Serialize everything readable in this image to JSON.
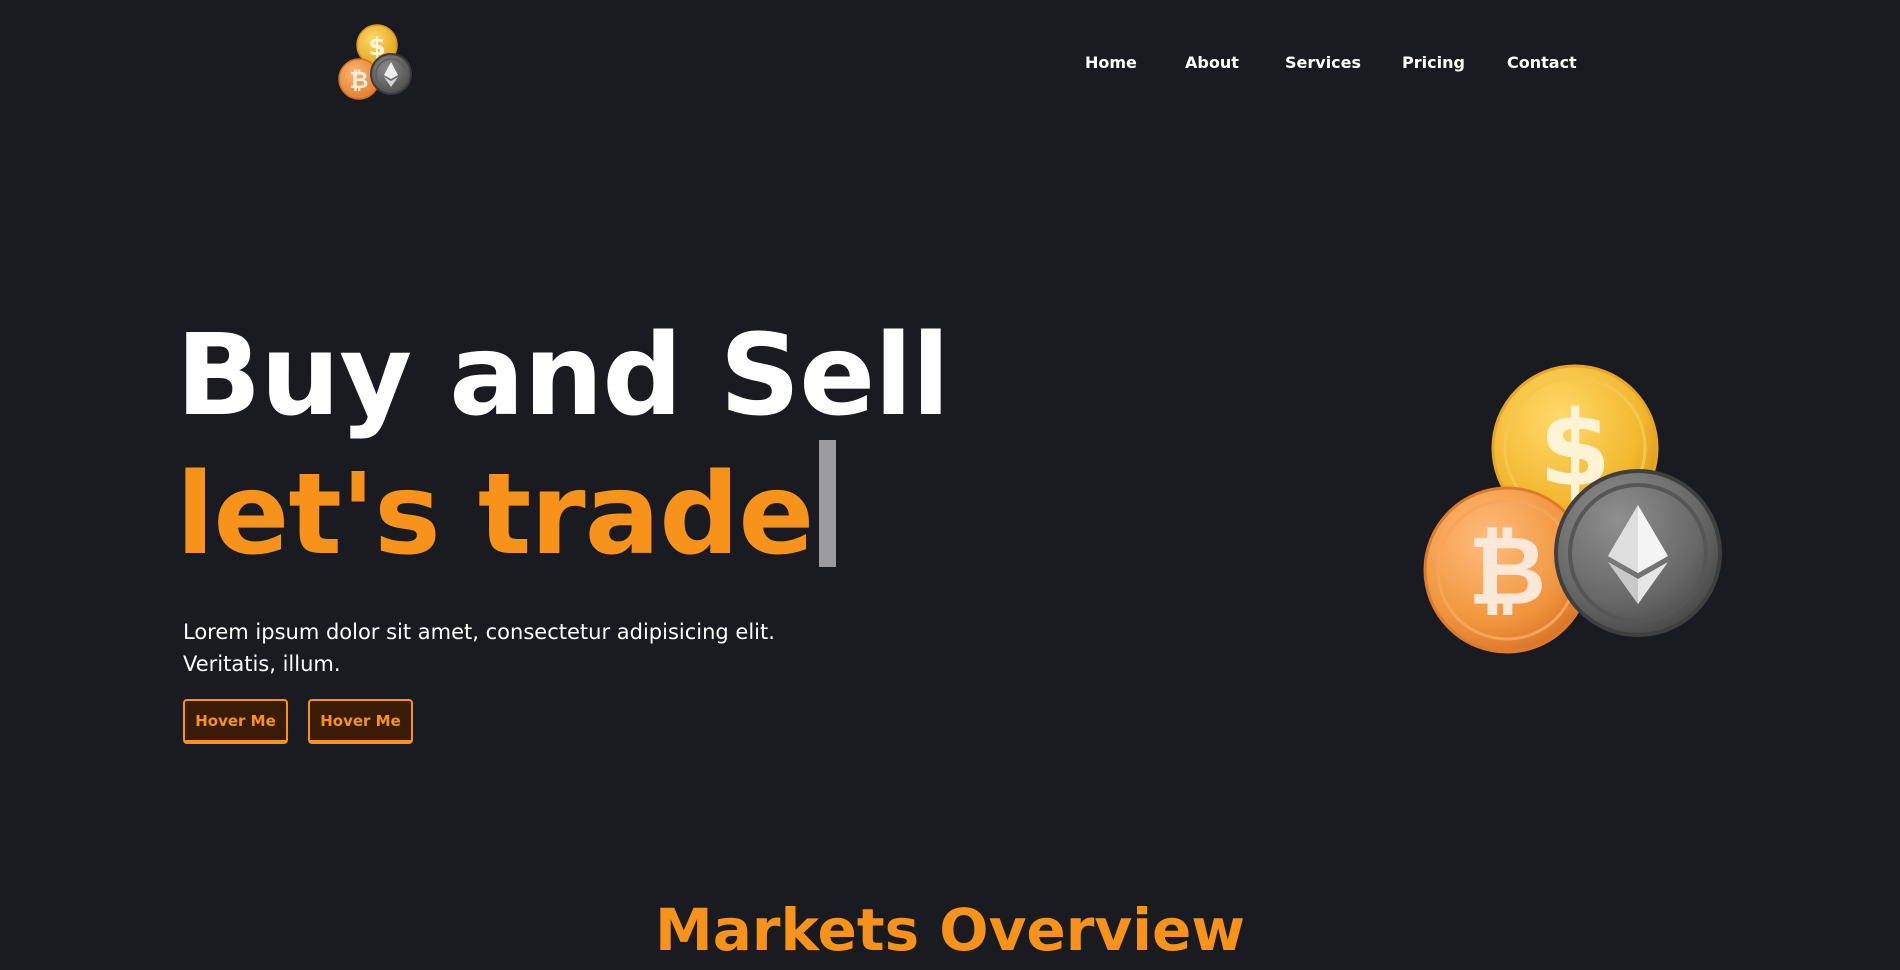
{
  "brand": {
    "logo_icon": "crypto-coins-icon"
  },
  "nav": {
    "items": [
      {
        "label": "Home"
      },
      {
        "label": "About"
      },
      {
        "label": "Services"
      },
      {
        "label": "Pricing"
      },
      {
        "label": "Contact"
      }
    ]
  },
  "hero": {
    "title_line1": "Buy and Sell",
    "title_line2": "let's trade",
    "description": "Lorem ipsum dolor sit amet, consectetur adipisicing elit. Veritatis, illum.",
    "buttons": [
      {
        "label": "Hover Me"
      },
      {
        "label": "Hover Me"
      }
    ],
    "illustration": "crypto-coins-illustration"
  },
  "markets": {
    "title": "Markets Overview"
  },
  "colors": {
    "background": "#1a1b21",
    "accent": "#f7931a",
    "text": "#ffffff",
    "button_fill": "#3a1c06"
  }
}
